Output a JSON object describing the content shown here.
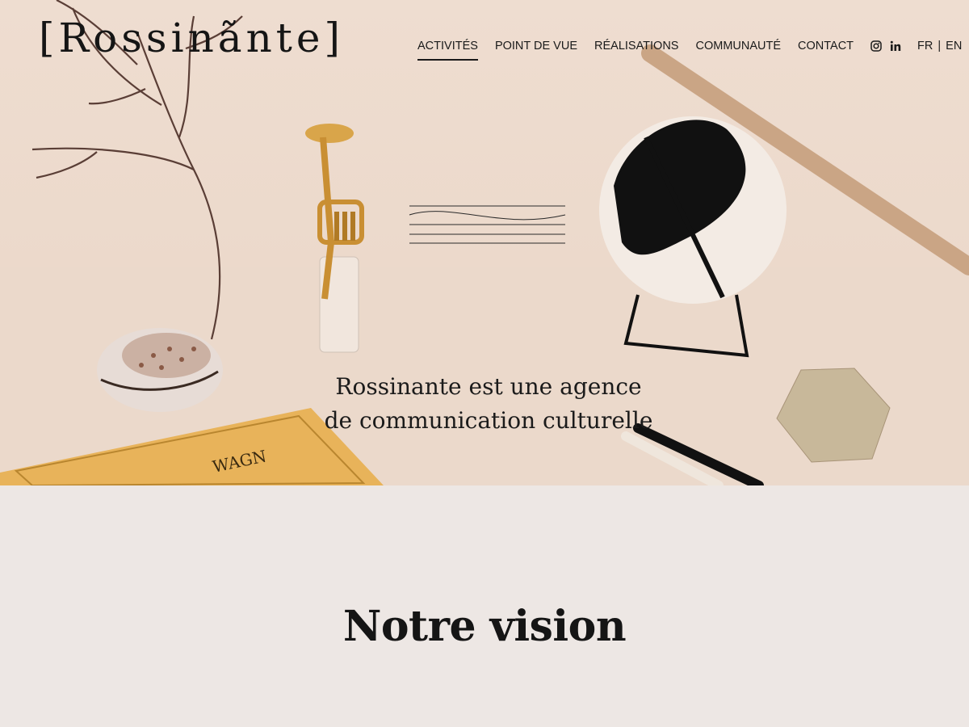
{
  "brand": {
    "logo_text": "[Rossinãnte]"
  },
  "nav": {
    "items": [
      {
        "label": "ACTIVITÉS",
        "active": true
      },
      {
        "label": "POINT DE VUE",
        "active": false
      },
      {
        "label": "RÉALISATIONS",
        "active": false
      },
      {
        "label": "COMMUNAUTÉ",
        "active": false
      },
      {
        "label": "CONTACT",
        "active": false
      }
    ],
    "social": [
      "instagram-icon",
      "linkedin-icon"
    ],
    "languages": [
      "FR",
      "EN"
    ],
    "lang_separator": "|"
  },
  "hero": {
    "tagline_line1": "Rossinante est une agence",
    "tagline_line2": "de communication culturelle",
    "book_text": "WAGN"
  },
  "vision": {
    "title": "Notre vision"
  },
  "colors": {
    "hero_bg": "#ecdacc",
    "page_bg": "#ede7e4",
    "text": "#1a1a1a",
    "book": "#e8b35a"
  }
}
